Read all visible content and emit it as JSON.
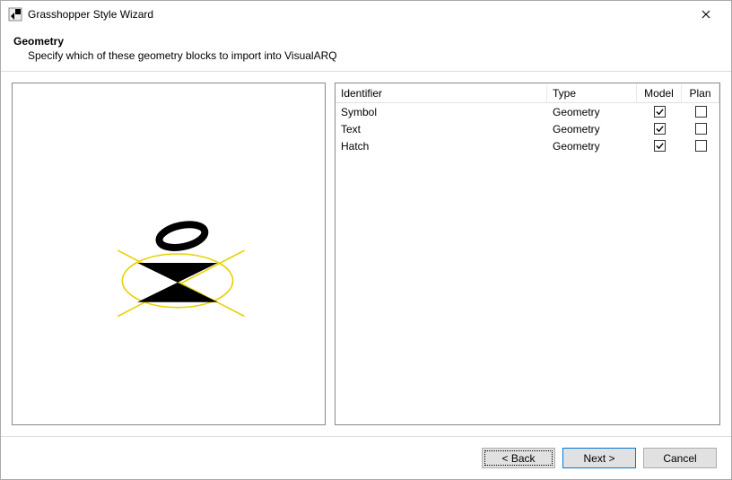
{
  "window": {
    "title": "Grasshopper Style Wizard"
  },
  "header": {
    "title": "Geometry",
    "subtitle": "Specify which of these geometry blocks to import into VisualARQ"
  },
  "table": {
    "columns": {
      "identifier": "Identifier",
      "type": "Type",
      "model": "Model",
      "plan": "Plan"
    },
    "rows": [
      {
        "identifier": "Symbol",
        "type": "Geometry",
        "model": true,
        "plan": false
      },
      {
        "identifier": "Text",
        "type": "Geometry",
        "model": true,
        "plan": false
      },
      {
        "identifier": "Hatch",
        "type": "Geometry",
        "model": true,
        "plan": false
      }
    ]
  },
  "footer": {
    "back": "< Back",
    "next": "Next >",
    "cancel": "Cancel"
  }
}
